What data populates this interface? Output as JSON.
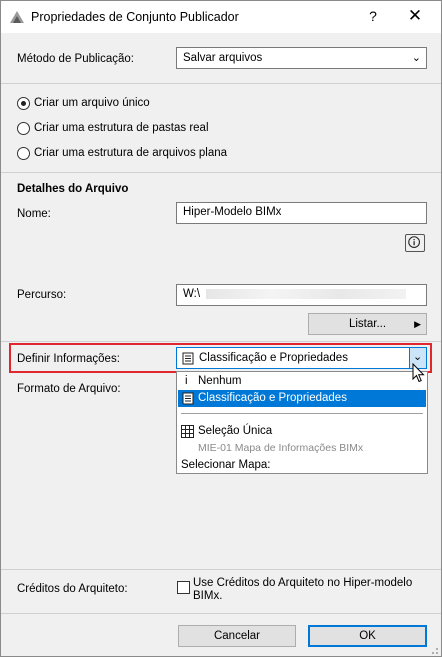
{
  "window": {
    "title": "Propriedades de Conjunto Publicador",
    "help_label": "?",
    "close_label": "✕"
  },
  "publish_method": {
    "label": "Método de Publicação:",
    "value": "Salvar arquivos"
  },
  "radios": [
    {
      "label": "Criar um arquivo único",
      "selected": true
    },
    {
      "label": "Criar uma estrutura de pastas real",
      "selected": false
    },
    {
      "label": "Criar uma estrutura de arquivos plana",
      "selected": false
    }
  ],
  "details": {
    "heading": "Detalhes do Arquivo",
    "name_label": "Nome:",
    "name_value": "Hiper-Modelo BIMx",
    "path_label": "Percurso:",
    "path_value": "W:\\",
    "list_button": "Listar..."
  },
  "define_info": {
    "label": "Definir Informações:",
    "value": "Classificação e Propriedades",
    "highlight_color": "#e0262e"
  },
  "file_format": {
    "label": "Formato de Arquivo:"
  },
  "dropdown": {
    "items": [
      {
        "label": "Nenhum",
        "icon": "info-icon"
      },
      {
        "label": "Classificação e Propriedades",
        "icon": "document-icon",
        "highlighted": true
      }
    ],
    "single_selection": "Seleção Única",
    "map_item": "MIE-01 Mapa de Informações BIMx",
    "select_map": "Selecionar Mapa:"
  },
  "architect_credits": {
    "label": "Créditos do Arquiteto:",
    "checkbox_label": "Use Créditos do Arquiteto no Hiper-modelo BIMx.",
    "checked": false
  },
  "footer": {
    "cancel": "Cancelar",
    "ok": "OK"
  },
  "colors": {
    "accent": "#0078d7",
    "window_bg": "#f0f0f0"
  }
}
